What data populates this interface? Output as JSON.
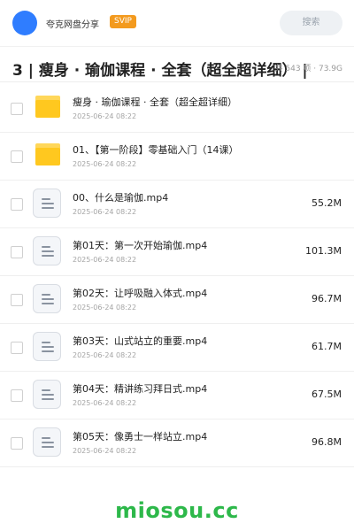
{
  "header": {
    "app_name": "夸克网盘分享",
    "vip_label": "SVIP",
    "search_label": "搜索"
  },
  "title_bar": {
    "title": "3 | 瘦身 · 瑜伽课程 · 全套（超全超详细） |",
    "meta": "共 543 项 · 73.9G"
  },
  "items": [
    {
      "type": "folder",
      "name": "瘦身 · 瑜伽课程 · 全套（超全超详细）",
      "date": "2025-06-24 08:22",
      "size": ""
    },
    {
      "type": "folder",
      "name": "01、【第一阶段】零基础入门（14课）",
      "date": "2025-06-24 08:22",
      "size": ""
    },
    {
      "type": "file",
      "name": "00、什么是瑜伽.mp4",
      "date": "2025-06-24 08:22",
      "size": "55.2M"
    },
    {
      "type": "file",
      "name": "第01天：第一次开始瑜伽.mp4",
      "date": "2025-06-24 08:22",
      "size": "101.3M"
    },
    {
      "type": "file",
      "name": "第02天：让呼吸融入体式.mp4",
      "date": "2025-06-24 08:22",
      "size": "96.7M"
    },
    {
      "type": "file",
      "name": "第03天：山式站立的重要.mp4",
      "date": "2025-06-24 08:22",
      "size": "61.7M"
    },
    {
      "type": "file",
      "name": "第04天：精讲练习拜日式.mp4",
      "date": "2025-06-24 08:22",
      "size": "67.5M"
    },
    {
      "type": "file",
      "name": "第05天：像勇士一样站立.mp4",
      "date": "2025-06-24 08:22",
      "size": "96.8M"
    }
  ],
  "footer": {
    "watermark": "miosou.cc"
  },
  "colors": {
    "avatar": "#2f7dff",
    "vip": "#f39a1e",
    "folder": "#ffc81f",
    "watermark": "#2db84a"
  }
}
